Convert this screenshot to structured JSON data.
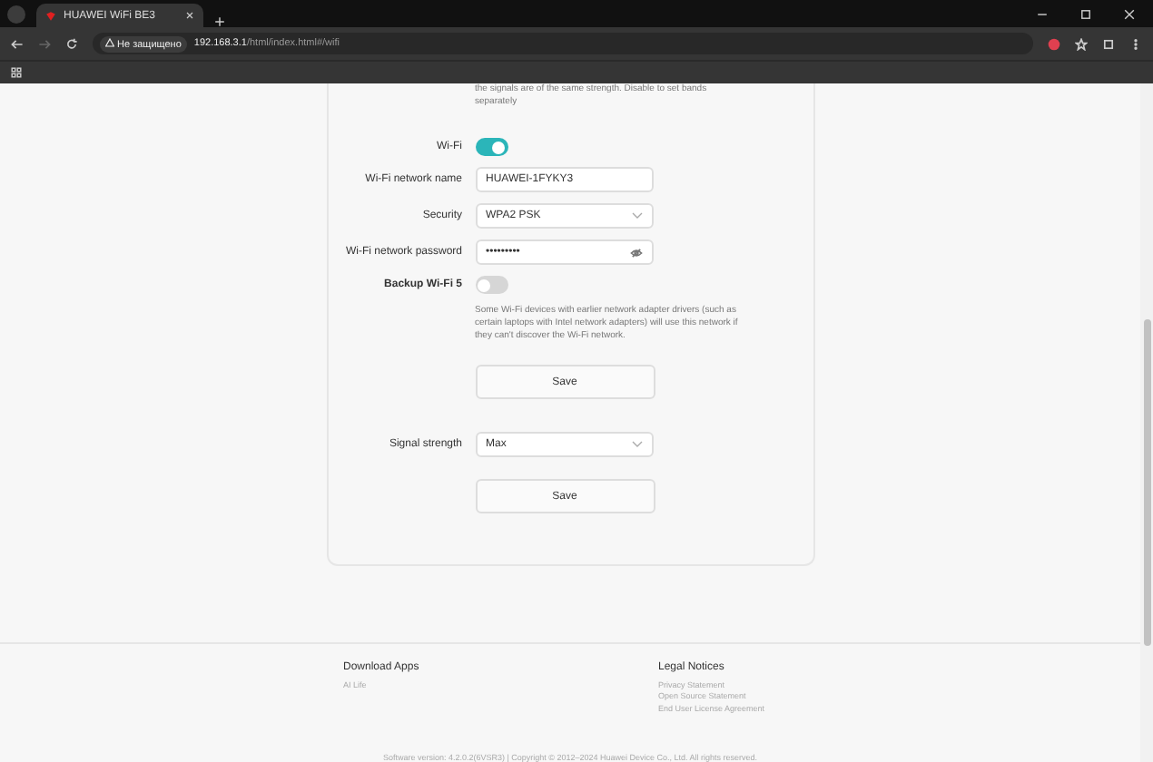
{
  "browser": {
    "tab_title": "HUAWEI WiFi BE3",
    "security_label": "Не защищено",
    "url_host": "192.168.3.1",
    "url_path": "/html/index.html#/wifi"
  },
  "settings": {
    "intro_note": "the signals are of the same strength. Disable to set bands separately",
    "rows": [
      {
        "kind": "toggle",
        "label": "Wi-Fi",
        "on": true
      },
      {
        "kind": "text",
        "label": "Wi-Fi network name",
        "value": "HUAWEI-1FYKY3"
      },
      {
        "kind": "select",
        "label": "Security",
        "value": "WPA2 PSK"
      },
      {
        "kind": "password",
        "label": "Wi-Fi network password",
        "value": "•••••••••"
      },
      {
        "kind": "toggle",
        "label": "Backup Wi-Fi 5",
        "on": false
      },
      {
        "kind": "note",
        "text": "Some Wi-Fi devices with earlier network adapter drivers (such as certain laptops with Intel network adapters) will use this network if they can't discover the Wi-Fi network."
      },
      {
        "kind": "button",
        "label": "Save"
      },
      {
        "kind": "select",
        "label": "Signal strength",
        "value": "Max"
      },
      {
        "kind": "button",
        "label": "Save"
      }
    ]
  },
  "footer": {
    "columns": [
      {
        "heading": "Download Apps",
        "links": [
          "AI Life"
        ]
      },
      {
        "heading": "Legal Notices",
        "links": [
          "Privacy Statement",
          "Open Source Statement",
          "End User License Agreement"
        ]
      }
    ],
    "copyright": "Software version: 4.2.0.2(6VSR3) | Copyright © 2012–2024 Huawei Device Co., Ltd. All rights reserved."
  }
}
